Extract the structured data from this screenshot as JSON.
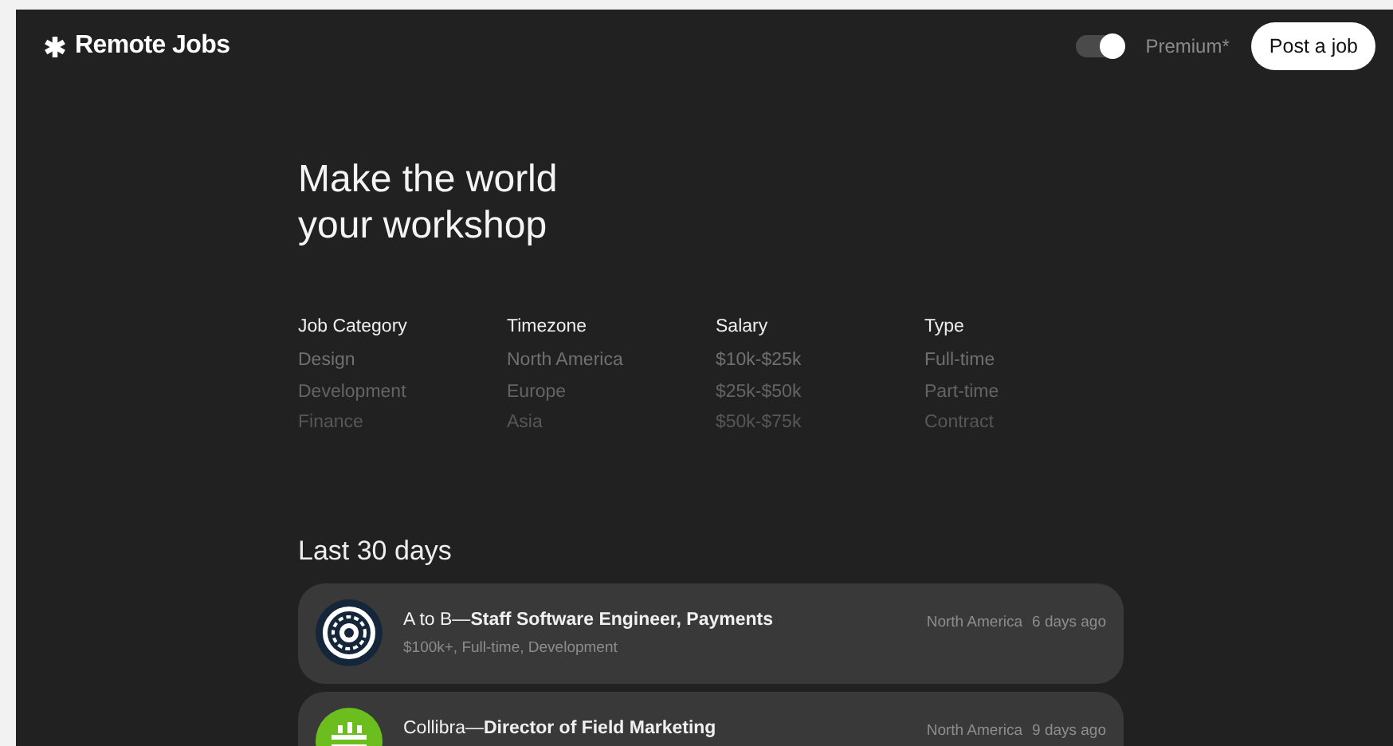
{
  "header": {
    "logo": "Remote Jobs",
    "toggle": {
      "on": true
    },
    "premium": "Premium*",
    "post_button": "Post a job"
  },
  "hero": {
    "title": "Make the world\nyour workshop"
  },
  "filters": [
    {
      "heading": "Job Category",
      "options": [
        "Design",
        "Development",
        "Finance"
      ]
    },
    {
      "heading": "Timezone",
      "options": [
        "North America",
        "Europe",
        "Asia"
      ]
    },
    {
      "heading": "Salary",
      "options": [
        "$10k-$25k",
        "$25k-$50k",
        "$50k-$75k"
      ]
    },
    {
      "heading": "Type",
      "options": [
        "Full-time",
        "Part-time",
        "Contract"
      ]
    }
  ],
  "section_title": "Last 30 days",
  "jobs": [
    {
      "kind": "ring",
      "title": "A to B—**Staff Software Engineer, Payments**",
      "details": "$100k+, Full-time, Development",
      "region": "North America",
      "age": "6 days ago"
    },
    {
      "kind": "grid",
      "title": "Collibra—**Director of Field Marketing**",
      "region": "North America",
      "age": "9 days ago"
    }
  ]
}
